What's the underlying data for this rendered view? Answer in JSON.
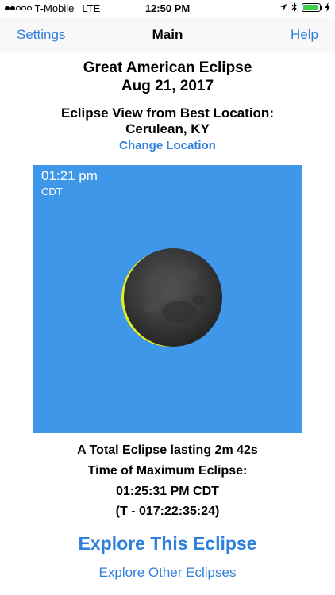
{
  "status_bar": {
    "carrier": "T-Mobile",
    "network": "LTE",
    "time": "12:50 PM",
    "icons": [
      "location-arrow-icon",
      "bluetooth-icon",
      "battery-icon",
      "charging-bolt-icon"
    ],
    "battery_level": 0.9,
    "signal_bars_on": 2,
    "signal_bars_total": 5
  },
  "nav": {
    "left_label": "Settings",
    "title": "Main",
    "right_label": "Help"
  },
  "header": {
    "title_line1": "Great American Eclipse",
    "title_line2": "Aug 21, 2017",
    "location_caption": "Eclipse View from Best Location:",
    "location_name": "Cerulean, KY",
    "change_location": "Change Location"
  },
  "eclipse_view": {
    "time": "01:21 pm",
    "timezone": "CDT",
    "sky_color": "#3e97e9",
    "sun_color": "#e8ef1a",
    "moon_color": "#3a3a3a"
  },
  "info": {
    "line1": "A Total Eclipse lasting 2m 42s",
    "line2": "Time of Maximum Eclipse:",
    "line3": "01:25:31 PM CDT",
    "line4": "(T - 017:22:35:24)"
  },
  "actions": {
    "explore": "Explore This Eclipse",
    "explore_other": "Explore Other Eclipses"
  },
  "colors": {
    "accent": "#2f7fdc",
    "battery_fill": "#3bd24a"
  }
}
